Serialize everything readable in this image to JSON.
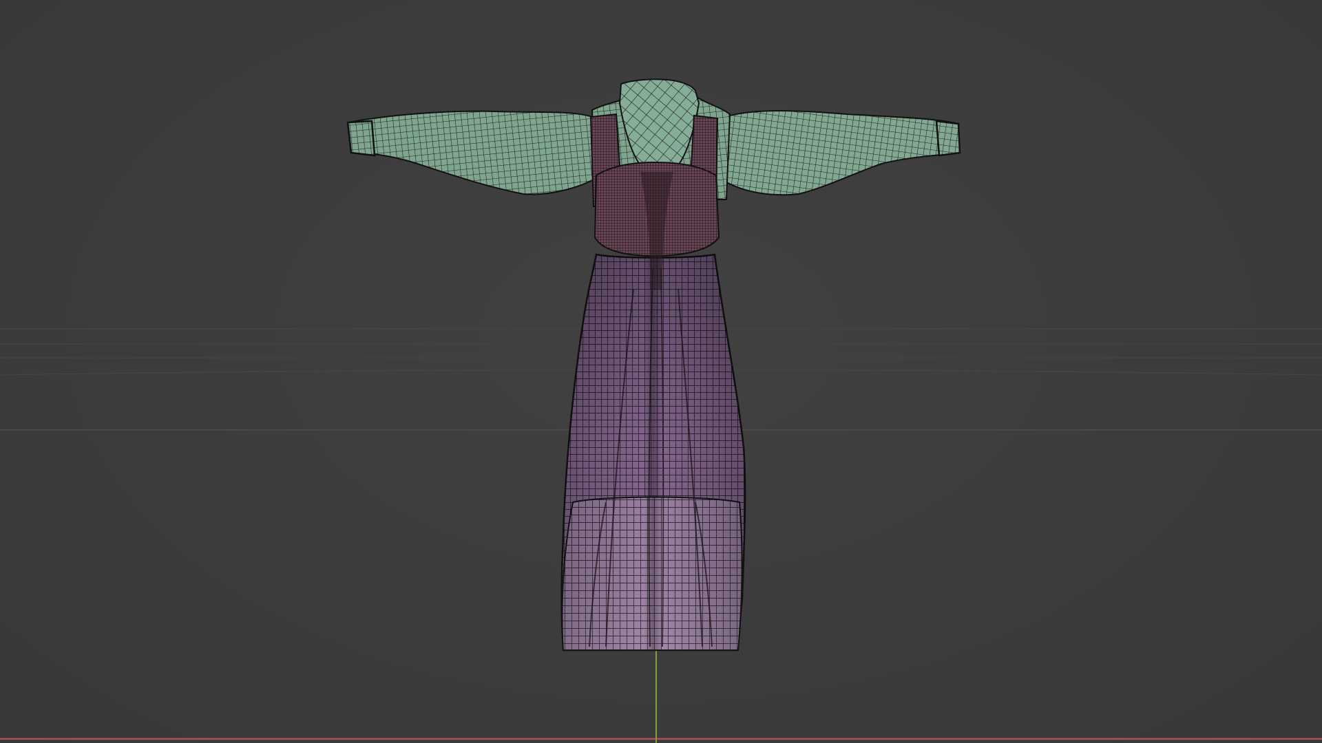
{
  "viewport": {
    "mode": "3d-viewport-wireframe-overlay",
    "background_color": "#3d3d3d"
  },
  "scene": {
    "object": "garment-mesh",
    "parts": [
      "blouse",
      "pinafore-bodice",
      "pinafore-skirt"
    ],
    "colors": {
      "blouse": "#7fa58f",
      "bodice": "#6b4656",
      "skirt": "#8a6a94",
      "wire": "#151515",
      "axis_x": "#b0505a",
      "axis_y": "#7fa33a",
      "grid": "#4a4a4a"
    }
  }
}
